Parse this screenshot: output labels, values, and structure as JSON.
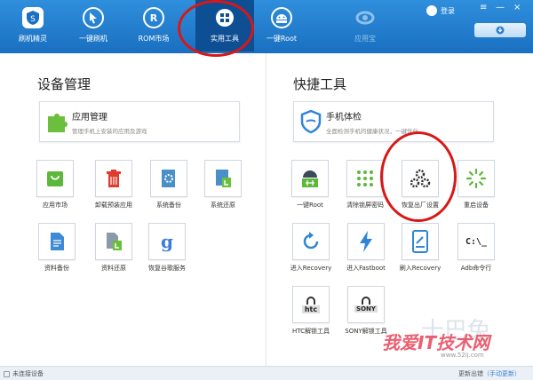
{
  "nav": {
    "items": [
      {
        "label": "刷机精灵",
        "icon": "shield-s-icon"
      },
      {
        "label": "一键刷机",
        "icon": "cursor-icon"
      },
      {
        "label": "ROM市场",
        "icon": "r-circle-icon"
      },
      {
        "label": "实用工具",
        "icon": "grid-icon",
        "active": true
      },
      {
        "label": "一键Root",
        "icon": "android-icon"
      },
      {
        "label": "应用宝",
        "icon": "yingyongbao-icon",
        "disabled": true
      }
    ],
    "login_label": "登录",
    "window_controls": [
      "≡",
      "—",
      "×"
    ]
  },
  "left": {
    "title": "设备管理",
    "card": {
      "title": "应用管理",
      "subtitle": "管理手机上安装的应用及游戏"
    },
    "tiles": [
      {
        "label": "应用市场"
      },
      {
        "label": "卸载预装应用"
      },
      {
        "label": "系统备份"
      },
      {
        "label": "系统还原"
      },
      {
        "label": "资料备份"
      },
      {
        "label": "资料还原"
      },
      {
        "label": "恢复谷歌服务"
      }
    ]
  },
  "right": {
    "title": "快捷工具",
    "card": {
      "title": "手机体检",
      "subtitle": "全面检测手机的健康状况，一键优化"
    },
    "tiles": [
      {
        "label": "一键Root"
      },
      {
        "label": "清除锁屏密码"
      },
      {
        "label": "恢复出厂设置"
      },
      {
        "label": "重启设备"
      },
      {
        "label": "进入Recovery"
      },
      {
        "label": "进入Fastboot"
      },
      {
        "label": "刷入Recovery"
      },
      {
        "label": "Adb命令行"
      },
      {
        "label": "HTC解锁工具"
      },
      {
        "label": "SONY解锁工具"
      }
    ],
    "adb_glyph": "C:\\_",
    "htc_glyph": "htc",
    "sony_glyph": "SONY"
  },
  "status": {
    "left": "未连接设备",
    "right_main": "更新出错",
    "right_paren": "（手动更新）"
  },
  "watermark": {
    "text": "我爱IT技术网",
    "url": "www.52ij.com",
    "ghost": "十巴兔"
  },
  "colors": {
    "accent": "#1a6fc0",
    "active_nav": "#0e4f93",
    "annotation": "#d81818",
    "green": "#5cb83a",
    "red": "#e03b2f"
  }
}
